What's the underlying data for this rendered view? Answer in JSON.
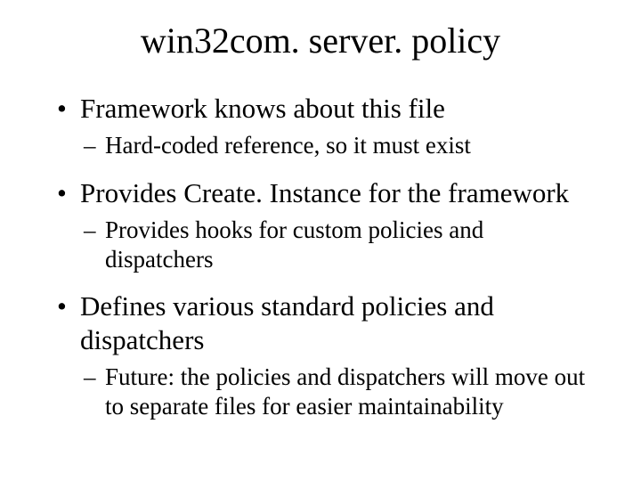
{
  "title": "win32com. server. policy",
  "bullets": [
    {
      "text": "Framework knows about this file",
      "sub": [
        "Hard-coded reference, so it must exist"
      ]
    },
    {
      "text": "Provides Create. Instance for the framework",
      "sub": [
        "Provides hooks for custom policies and dispatchers"
      ]
    },
    {
      "text": "Defines various standard policies and dispatchers",
      "sub": [
        "Future: the policies and dispatchers will move out to separate files for easier maintainability"
      ]
    }
  ]
}
